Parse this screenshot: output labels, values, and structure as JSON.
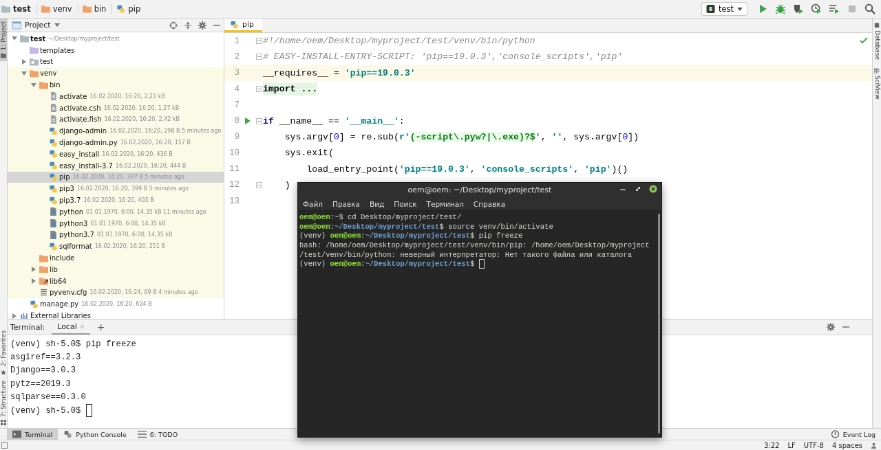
{
  "breadcrumbs": [
    {
      "label": "test",
      "kind": "folder"
    },
    {
      "label": "venv",
      "kind": "excluded"
    },
    {
      "label": "bin",
      "kind": "excluded"
    },
    {
      "label": "pip",
      "kind": "python"
    }
  ],
  "run_config": {
    "label": "test"
  },
  "toolbar": [
    {
      "kind": "run",
      "disabled": false
    },
    {
      "kind": "debug",
      "disabled": false
    },
    {
      "kind": "coverage",
      "disabled": false
    },
    {
      "kind": "profile",
      "disabled": false
    },
    {
      "kind": "concurrency",
      "disabled": false
    },
    {
      "kind": "stop",
      "disabled": true
    },
    {
      "kind": "search",
      "disabled": false
    }
  ],
  "left_stripe": [
    {
      "label": "1: Project",
      "kind": "folder",
      "selected": true
    },
    {
      "label": "2: Favorites",
      "kind": "star",
      "selected": false
    },
    {
      "label": "7: Structure",
      "kind": "structure",
      "selected": false
    }
  ],
  "right_stripe": [
    {
      "label": "Database",
      "kind": "database"
    },
    {
      "label": "SciView",
      "kind": "grid"
    }
  ],
  "project": {
    "title": "Project",
    "tree": [
      {
        "name": "test",
        "meta": "~/Desktop/myproject/test",
        "kind": "folder",
        "bold": true,
        "expanded": true,
        "selected": false,
        "children": [
          {
            "name": "templates",
            "kind": "template-folder",
            "selected": false
          },
          {
            "name": "test",
            "kind": "package",
            "expanded": false,
            "selected": false
          },
          {
            "name": "venv",
            "kind": "excluded",
            "expanded": true,
            "selected": false,
            "children": [
              {
                "name": "bin",
                "kind": "excluded",
                "expanded": true,
                "selected": false,
                "children": [
                  {
                    "name": "activate",
                    "meta": "16.02.2020, 16:20, 2,21 kB",
                    "kind": "script",
                    "selected": false
                  },
                  {
                    "name": "activate.csh",
                    "meta": "16.02.2020, 16:20, 1,27 kB",
                    "kind": "script",
                    "selected": false
                  },
                  {
                    "name": "activate.fish",
                    "meta": "16.02.2020, 16:20, 2,42 kB",
                    "kind": "script",
                    "selected": false
                  },
                  {
                    "name": "django-admin",
                    "meta": "16.02.2020, 16:20, 298 B 5 minutes ago",
                    "kind": "python",
                    "selected": false
                  },
                  {
                    "name": "django-admin.py",
                    "meta": "16.02.2020, 16:20, 157 B",
                    "kind": "python",
                    "selected": false
                  },
                  {
                    "name": "easy_install",
                    "meta": "16.02.2020, 16:20, 436 B",
                    "kind": "python",
                    "selected": false
                  },
                  {
                    "name": "easy_install-3.7",
                    "meta": "16.02.2020, 16:20, 444 B",
                    "kind": "python",
                    "selected": false
                  },
                  {
                    "name": "pip",
                    "meta": "16.02.2020, 16:20, 397 B 5 minutes ago",
                    "kind": "python",
                    "selected": true
                  },
                  {
                    "name": "pip3",
                    "meta": "16.02.2020, 16:20, 399 B 5 minutes ago",
                    "kind": "python",
                    "selected": false
                  },
                  {
                    "name": "pip3.7",
                    "meta": "16.02.2020, 16:20, 403 B",
                    "kind": "python",
                    "selected": false
                  },
                  {
                    "name": "python",
                    "meta": "01.01.1970, 6:00, 14,35 kB 11 minutes ago",
                    "kind": "binary",
                    "selected": false
                  },
                  {
                    "name": "python3",
                    "meta": "01.01.1970, 6:00, 14,35 kB",
                    "kind": "binary",
                    "selected": false
                  },
                  {
                    "name": "python3.7",
                    "meta": "01.01.1970, 6:00, 14,35 kB",
                    "kind": "binary",
                    "selected": false
                  },
                  {
                    "name": "sqlformat",
                    "meta": "16.02.2020, 16:20, 251 B",
                    "kind": "python",
                    "selected": false
                  }
                ]
              },
              {
                "name": "include",
                "kind": "excluded",
                "selected": false
              },
              {
                "name": "lib",
                "kind": "excluded",
                "expanded": false,
                "selected": false
              },
              {
                "name": "lib64",
                "kind": "linked",
                "expanded": false,
                "selected": false
              },
              {
                "name": "pyvenv.cfg",
                "meta": "16.02.2020, 16:24, 69 B 4 minutes ago",
                "kind": "config",
                "selected": false
              }
            ]
          },
          {
            "name": "manage.py",
            "meta": "16.02.2020, 16:20, 624 B",
            "kind": "python",
            "selected": false
          }
        ]
      },
      {
        "name": "External Libraries",
        "kind": "library",
        "expanded": false,
        "selected": false
      }
    ]
  },
  "editor": {
    "tabs": [
      {
        "label": "pip",
        "selected": true
      }
    ],
    "lines": [
      {
        "number": "1",
        "fold": true,
        "run": false,
        "current": false,
        "tokens": [
          {
            "kind": "comment",
            "text": "#!/home/oem/Desktop/myproject/test/venv/bin/python"
          }
        ]
      },
      {
        "number": "2",
        "fold": true,
        "run": false,
        "current": false,
        "tokens": [
          {
            "kind": "comment",
            "text": "# EASY-INSTALL-ENTRY-SCRIPT: 'pip==19.0.3','console_scripts','pip'"
          }
        ]
      },
      {
        "number": "3",
        "fold": false,
        "run": false,
        "current": true,
        "tokens": [
          {
            "kind": "plain",
            "text": "__requires__ = "
          },
          {
            "kind": "string",
            "text": "'pip==19.0.3'"
          }
        ]
      },
      {
        "number": "4",
        "fold": true,
        "run": false,
        "current": false,
        "tokens": [
          {
            "kind": "folded",
            "text": "import ..."
          }
        ]
      },
      {
        "number": "7",
        "fold": false,
        "run": false,
        "current": false
      },
      {
        "number": "8",
        "fold": true,
        "run": true,
        "current": false,
        "tokens": [
          {
            "kind": "keyword",
            "text": "if"
          },
          {
            "kind": "plain",
            "text": " __name__ == "
          },
          {
            "kind": "string",
            "text": "'__main__'"
          },
          {
            "kind": "plain",
            "text": ":"
          }
        ]
      },
      {
        "number": "9",
        "fold": false,
        "run": false,
        "current": false,
        "tokens": [
          {
            "kind": "plain",
            "text": "    sys.argv["
          },
          {
            "kind": "number",
            "text": "0"
          },
          {
            "kind": "plain",
            "text": "] = re.sub("
          },
          {
            "kind": "string",
            "text": "r'"
          },
          {
            "kind": "regex",
            "text": "(-script\\.pyw?|\\.exe)?$"
          },
          {
            "kind": "string",
            "text": "'"
          },
          {
            "kind": "plain",
            "text": ", "
          },
          {
            "kind": "string",
            "text": "''"
          },
          {
            "kind": "plain",
            "text": ", sys.argv["
          },
          {
            "kind": "number",
            "text": "0"
          },
          {
            "kind": "plain",
            "text": "])"
          }
        ]
      },
      {
        "number": "10",
        "fold": false,
        "run": false,
        "current": false,
        "tokens": [
          {
            "kind": "plain",
            "text": "    sys.exit("
          }
        ]
      },
      {
        "number": "11",
        "fold": false,
        "run": false,
        "current": false,
        "tokens": [
          {
            "kind": "plain",
            "text": "        load_entry_point("
          },
          {
            "kind": "string",
            "text": "'pip==19.0.3'"
          },
          {
            "kind": "plain",
            "text": ", "
          },
          {
            "kind": "string",
            "text": "'console_scripts'"
          },
          {
            "kind": "plain",
            "text": ", "
          },
          {
            "kind": "string",
            "text": "'pip'"
          },
          {
            "kind": "plain",
            "text": ")()"
          }
        ]
      },
      {
        "number": "12",
        "fold": true,
        "run": false,
        "current": false,
        "tokens": [
          {
            "kind": "plain",
            "text": "    )"
          }
        ]
      },
      {
        "number": "13",
        "fold": false,
        "run": false,
        "current": false
      }
    ]
  },
  "terminal_panel": {
    "label": "Terminal:",
    "tabs": [
      {
        "label": "Local",
        "selected": true
      }
    ],
    "add": "+",
    "lines": [
      {
        "text": "(venv) sh-5.0$ pip freeze",
        "cursor": false
      },
      {
        "text": "asgiref==3.2.3",
        "cursor": false
      },
      {
        "text": "Django==3.0.3",
        "cursor": false
      },
      {
        "text": "pytz==2019.3",
        "cursor": false
      },
      {
        "text": "sqlparse==0.3.0",
        "cursor": false
      },
      {
        "text": "(venv) sh-5.0$ ",
        "cursor": true
      }
    ]
  },
  "tool_tabs": [
    {
      "label": "Terminal",
      "kind": "terminal",
      "selected": true
    },
    {
      "label": "Python Console",
      "kind": "python",
      "selected": false
    },
    {
      "label": "6: TODO",
      "kind": "todo",
      "selected": false
    }
  ],
  "event_log": {
    "label": "Event Log"
  },
  "status_bar": [
    "3:22",
    "LF",
    "UTF-8",
    "4 spaces"
  ],
  "terminal_window": {
    "title": "oem@oem: ~/Desktop/myproject/test",
    "menu": [
      "Файл",
      "Правка",
      "Вид",
      "Поиск",
      "Терминал",
      "Справка"
    ],
    "lines": [
      {
        "cursor": false,
        "segments": [
          {
            "kind": "user",
            "text": "oem@oem"
          },
          {
            "kind": "plain",
            "text": ":~$ cd Desktop/myproject/test/"
          }
        ]
      },
      {
        "cursor": false,
        "segments": [
          {
            "kind": "user",
            "text": "oem@oem"
          },
          {
            "kind": "plain",
            "text": ":"
          },
          {
            "kind": "path",
            "text": "~/Desktop/myproject/test"
          },
          {
            "kind": "plain",
            "text": "$ source venv/bin/activate"
          }
        ]
      },
      {
        "cursor": false,
        "segments": [
          {
            "kind": "plain",
            "text": "(venv) "
          },
          {
            "kind": "user",
            "text": "oem@oem"
          },
          {
            "kind": "plain",
            "text": ":"
          },
          {
            "kind": "path",
            "text": "~/Desktop/myproject/test"
          },
          {
            "kind": "plain",
            "text": "$ pip freeze"
          }
        ]
      },
      {
        "cursor": false,
        "segments": [
          {
            "kind": "plain",
            "text": "bash: /home/oem/Desktop/myproject/test/venv/bin/pip: /home/oem/Desktop/myproject"
          }
        ]
      },
      {
        "cursor": false,
        "segments": [
          {
            "kind": "plain",
            "text": "/test/venv/bin/python: неверный интерпретатор: Нет такого файла или каталога"
          }
        ]
      },
      {
        "cursor": true,
        "segments": [
          {
            "kind": "plain",
            "text": "(venv) "
          },
          {
            "kind": "user",
            "text": "oem@oem"
          },
          {
            "kind": "plain",
            "text": ":"
          },
          {
            "kind": "path",
            "text": "~/Desktop/myproject/test"
          },
          {
            "kind": "plain",
            "text": "$ "
          }
        ]
      }
    ]
  }
}
